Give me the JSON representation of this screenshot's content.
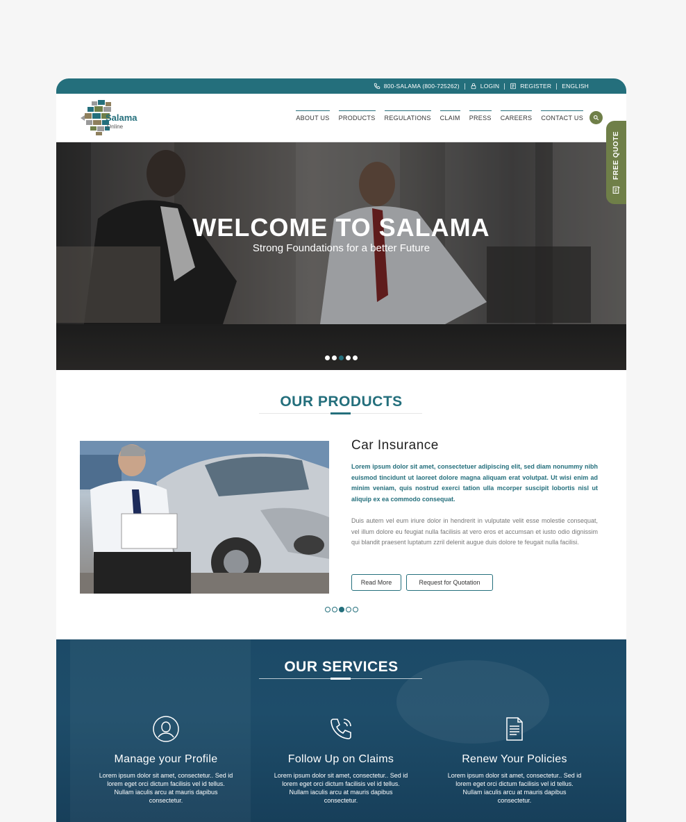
{
  "topbar": {
    "phone": "800-SALAMA (800-725262)",
    "login": "LOGIN",
    "register": "REGISTER",
    "language": "ENGLISH"
  },
  "logo": {
    "name_a": "Sa",
    "name_b": "lama",
    "tagline": "Online"
  },
  "nav": {
    "items": [
      "ABOUT US",
      "PRODUCTS",
      "REGULATIONS",
      "CLAIM",
      "PRESS",
      "CAREERS",
      "CONTACT US"
    ]
  },
  "free_quote": "FREE QUOTE",
  "hero": {
    "title": "WELCOME TO SALAMA",
    "subtitle": "Strong Foundations for a better Future",
    "slide_count": 5,
    "active_slide": 3
  },
  "products": {
    "heading": "OUR PRODUCTS",
    "title": "Car Insurance",
    "lead": "Lorem ipsum dolor sit amet, consectetuer adipiscing elit, sed diam nonummy nibh euismod tincidunt ut laoreet dolore magna aliquam erat volutpat. Ut wisi enim ad minim veniam, quis nostrud exerci tation ulla mcorper suscipit lobortis nisl ut aliquip ex ea commodo consequat.",
    "body": "Duis autem vel eum iriure dolor in hendrerit in vulputate velit esse molestie consequat, vel illum dolore eu feugiat nulla facilisis at vero eros et accumsan et iusto odio dignissim qui blandit praesent luptatum zzril delenit augue duis dolore te feugait nulla facilisi.",
    "read_more": "Read More",
    "request_quote": "Request for Quotation",
    "slide_count": 5,
    "active_slide": 3
  },
  "services": {
    "heading": "OUR SERVICES",
    "items": [
      {
        "title": "Manage your Profile",
        "desc": "Lorem ipsum dolor sit amet, consectetur.. Sed id lorem eget orci dictum facilisis vel id tellus. Nullam iaculis arcu at mauris dapibus consectetur.",
        "icon": "user-profile-icon"
      },
      {
        "title": "Follow Up on Claims",
        "desc": "Lorem ipsum dolor sit amet, consectetur.. Sed id lorem eget orci dictum facilisis vel id tellus. Nullam iaculis arcu at mauris dapibus consectetur.",
        "icon": "phone-call-icon"
      },
      {
        "title": "Renew Your Policies",
        "desc": "Lorem ipsum dolor sit amet, consectetur.. Sed id lorem eget orci dictum facilisis vel id tellus. Nullam iaculis arcu at mauris dapibus consectetur.",
        "icon": "document-icon"
      }
    ]
  },
  "colors": {
    "brand_teal": "#246f7c",
    "brand_olive": "#6f7f48",
    "services_bg": "#1c4a67"
  }
}
